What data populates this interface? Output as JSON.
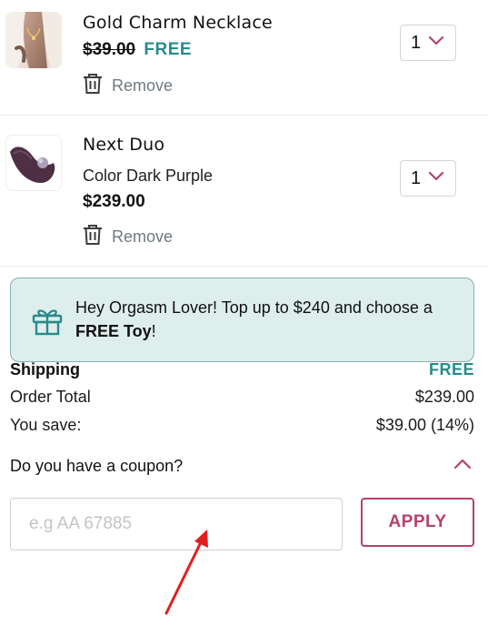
{
  "cart": {
    "items": [
      {
        "name": "Gold Charm Necklace",
        "old_price": "$39.00",
        "free_label": "FREE",
        "remove_label": "Remove",
        "quantity": "1",
        "thumbnail": "necklace-photo"
      },
      {
        "name": "Next Duo",
        "color": "Color Dark Purple",
        "price": "$239.00",
        "remove_label": "Remove",
        "quantity": "1",
        "thumbnail": "purple-toy-photo"
      }
    ]
  },
  "banner": {
    "text_prefix": "Hey Orgasm Lover! Top up to $240 and choose a ",
    "text_bold": "FREE Toy",
    "text_suffix": "!",
    "icon": "gift-icon"
  },
  "summary": {
    "shipping_label": "Shipping",
    "shipping_value": "FREE",
    "order_total_label": "Order Total",
    "order_total_value": "$239.00",
    "you_save_label": "You save:",
    "you_save_value": "$39.00 (14%)"
  },
  "coupon": {
    "question": "Do you have a coupon?",
    "placeholder": "e.g AA 67885",
    "value": "",
    "apply_label": "APPLY",
    "expanded": true
  },
  "colors": {
    "teal": "#2a8a8a",
    "banner_bg": "#deeeec",
    "accent": "#b5426b",
    "annotation_arrow": "#e02020"
  }
}
